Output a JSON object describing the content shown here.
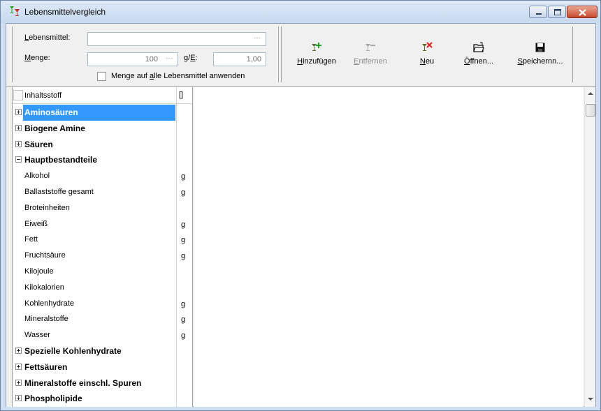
{
  "window": {
    "title": "Lebensmittelvergleich",
    "icon": "app-wineglass-icon"
  },
  "form": {
    "lebensmittel_label_u": "L",
    "lebensmittel_label_rest": "ebensmittel:",
    "lebensmittel_value": "",
    "menge_label_u": "M",
    "menge_label_rest": "enge:",
    "menge_value": "100",
    "ge_label_pre": "g/",
    "ge_label_u": "E",
    "ge_label_post": ":",
    "ge_value": "1,00",
    "ellipsis": "···",
    "apply_all_pre": "Menge auf ",
    "apply_all_u": "a",
    "apply_all_post": "lle Lebensmittel anwenden",
    "apply_all_checked": false
  },
  "toolbar": {
    "add_u": "H",
    "add_rest": "inzufügen",
    "remove_u": "E",
    "remove_rest": "ntfernen",
    "new_u": "N",
    "new_rest": "eu",
    "open_u": "Ö",
    "open_rest": "ffnen...",
    "save_u": "S",
    "save_rest": "peichernn..."
  },
  "list": {
    "header_name": "Inhaltsstoff",
    "header_unit": "[]",
    "rows": [
      {
        "name": "Aminosäuren",
        "unit": "",
        "type": "category",
        "expander": "plus",
        "selected": true
      },
      {
        "name": "Biogene Amine",
        "unit": "",
        "type": "category",
        "expander": "plus",
        "selected": false
      },
      {
        "name": "Säuren",
        "unit": "",
        "type": "category",
        "expander": "plus",
        "selected": false
      },
      {
        "name": "Hauptbestandteile",
        "unit": "",
        "type": "category",
        "expander": "minus",
        "selected": false
      },
      {
        "name": "Alkohol",
        "unit": "g",
        "type": "item"
      },
      {
        "name": "Ballaststoffe gesamt",
        "unit": "g",
        "type": "item"
      },
      {
        "name": "Broteinheiten",
        "unit": "",
        "type": "item"
      },
      {
        "name": "Eiweiß",
        "unit": "g",
        "type": "item"
      },
      {
        "name": "Fett",
        "unit": "g",
        "type": "item"
      },
      {
        "name": "Fruchtsäure",
        "unit": "g",
        "type": "item"
      },
      {
        "name": "Kilojoule",
        "unit": "",
        "type": "item"
      },
      {
        "name": "Kilokalorien",
        "unit": "",
        "type": "item"
      },
      {
        "name": "Kohlenhydrate",
        "unit": "g",
        "type": "item"
      },
      {
        "name": "Mineralstoffe",
        "unit": "g",
        "type": "item"
      },
      {
        "name": "Wasser",
        "unit": "g",
        "type": "item"
      },
      {
        "name": "Spezielle Kohlenhydrate",
        "unit": "",
        "type": "category",
        "expander": "plus",
        "selected": false
      },
      {
        "name": "Fettsäuren",
        "unit": "",
        "type": "category",
        "expander": "plus",
        "selected": false
      },
      {
        "name": "Mineralstoffe einschl. Spuren",
        "unit": "",
        "type": "category",
        "expander": "plus",
        "selected": false
      },
      {
        "name": "Phospholipide",
        "unit": "",
        "type": "category",
        "expander": "plus",
        "selected": false
      }
    ]
  },
  "colors": {
    "selection": "#3399ff",
    "titlebar": "#c7d9ef",
    "close_button": "#c8482b"
  }
}
